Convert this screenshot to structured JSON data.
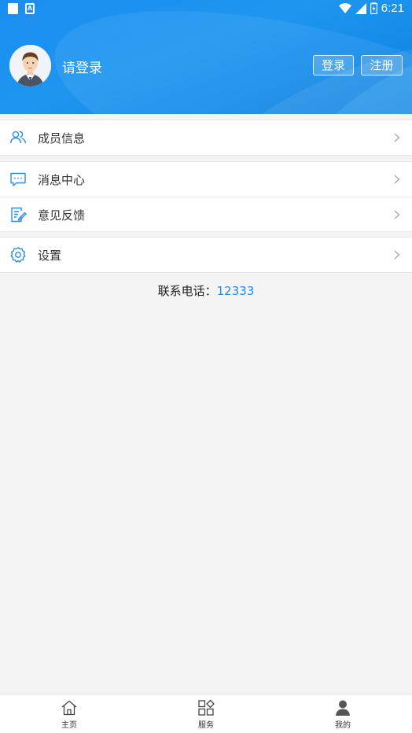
{
  "status_bar": {
    "time": "6:21"
  },
  "header": {
    "login_prompt": "请登录",
    "login_button": "登录",
    "register_button": "注册"
  },
  "menu": {
    "member_info": "成员信息",
    "message_center": "消息中心",
    "feedback": "意见反馈",
    "settings": "设置"
  },
  "contact": {
    "label": "联系电话：",
    "phone": "12333"
  },
  "tabbar": {
    "home": "主页",
    "service": "服务",
    "mine": "我的"
  },
  "colors": {
    "accent": "#1a8ef0"
  }
}
